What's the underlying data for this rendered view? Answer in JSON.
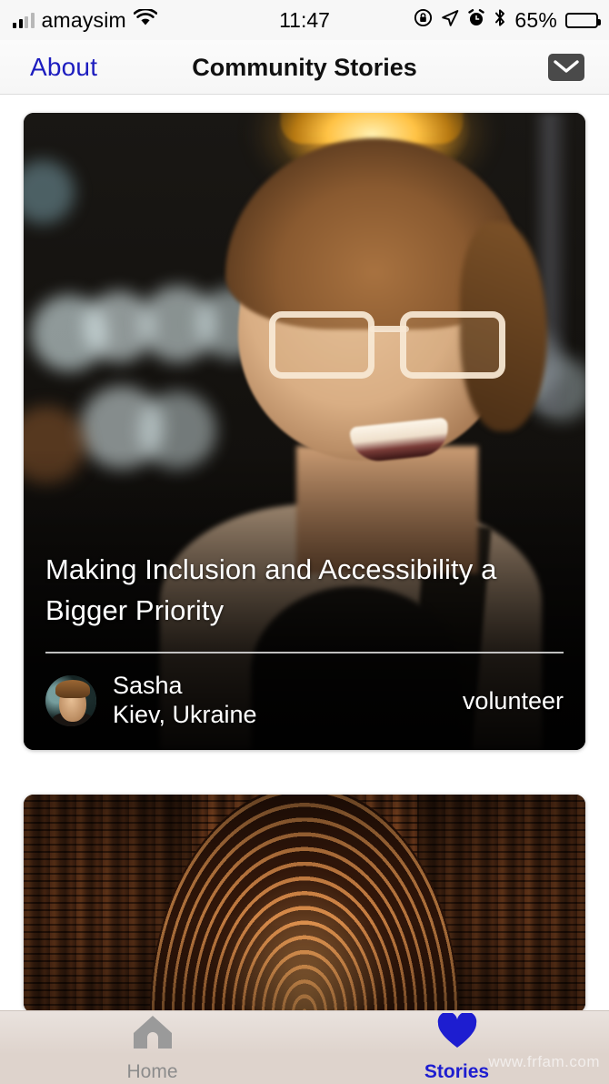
{
  "status_bar": {
    "carrier": "amaysim",
    "time": "11:47",
    "battery_percent": "65%",
    "icons": [
      "signal-bars-icon",
      "wifi-icon",
      "rotation-lock-icon",
      "location-arrow-icon",
      "alarm-clock-icon",
      "bluetooth-icon",
      "battery-icon"
    ]
  },
  "nav_bar": {
    "back_label": "About",
    "title": "Community Stories",
    "mail_icon": "envelope-icon",
    "tint_color": "#1d1dbf"
  },
  "stories": [
    {
      "title": "Making Inclusion and Accessibility a Bigger Priority",
      "author_name": "Sasha",
      "author_location": "Kiev, Ukraine",
      "role": "volunteer",
      "image_alt": "smiling-woman-with-glasses-photo"
    },
    {
      "title": "",
      "author_name": "",
      "author_location": "",
      "role": "",
      "image_alt": "brick-arches-corridor-photo"
    }
  ],
  "tab_bar": {
    "items": [
      {
        "label": "Home",
        "icon": "home-icon",
        "active": false
      },
      {
        "label": "Stories",
        "icon": "heart-icon",
        "active": true
      }
    ],
    "active_color": "#1d1dd0",
    "inactive_color": "#8c8c8c"
  },
  "watermark": "www.frfam.com"
}
